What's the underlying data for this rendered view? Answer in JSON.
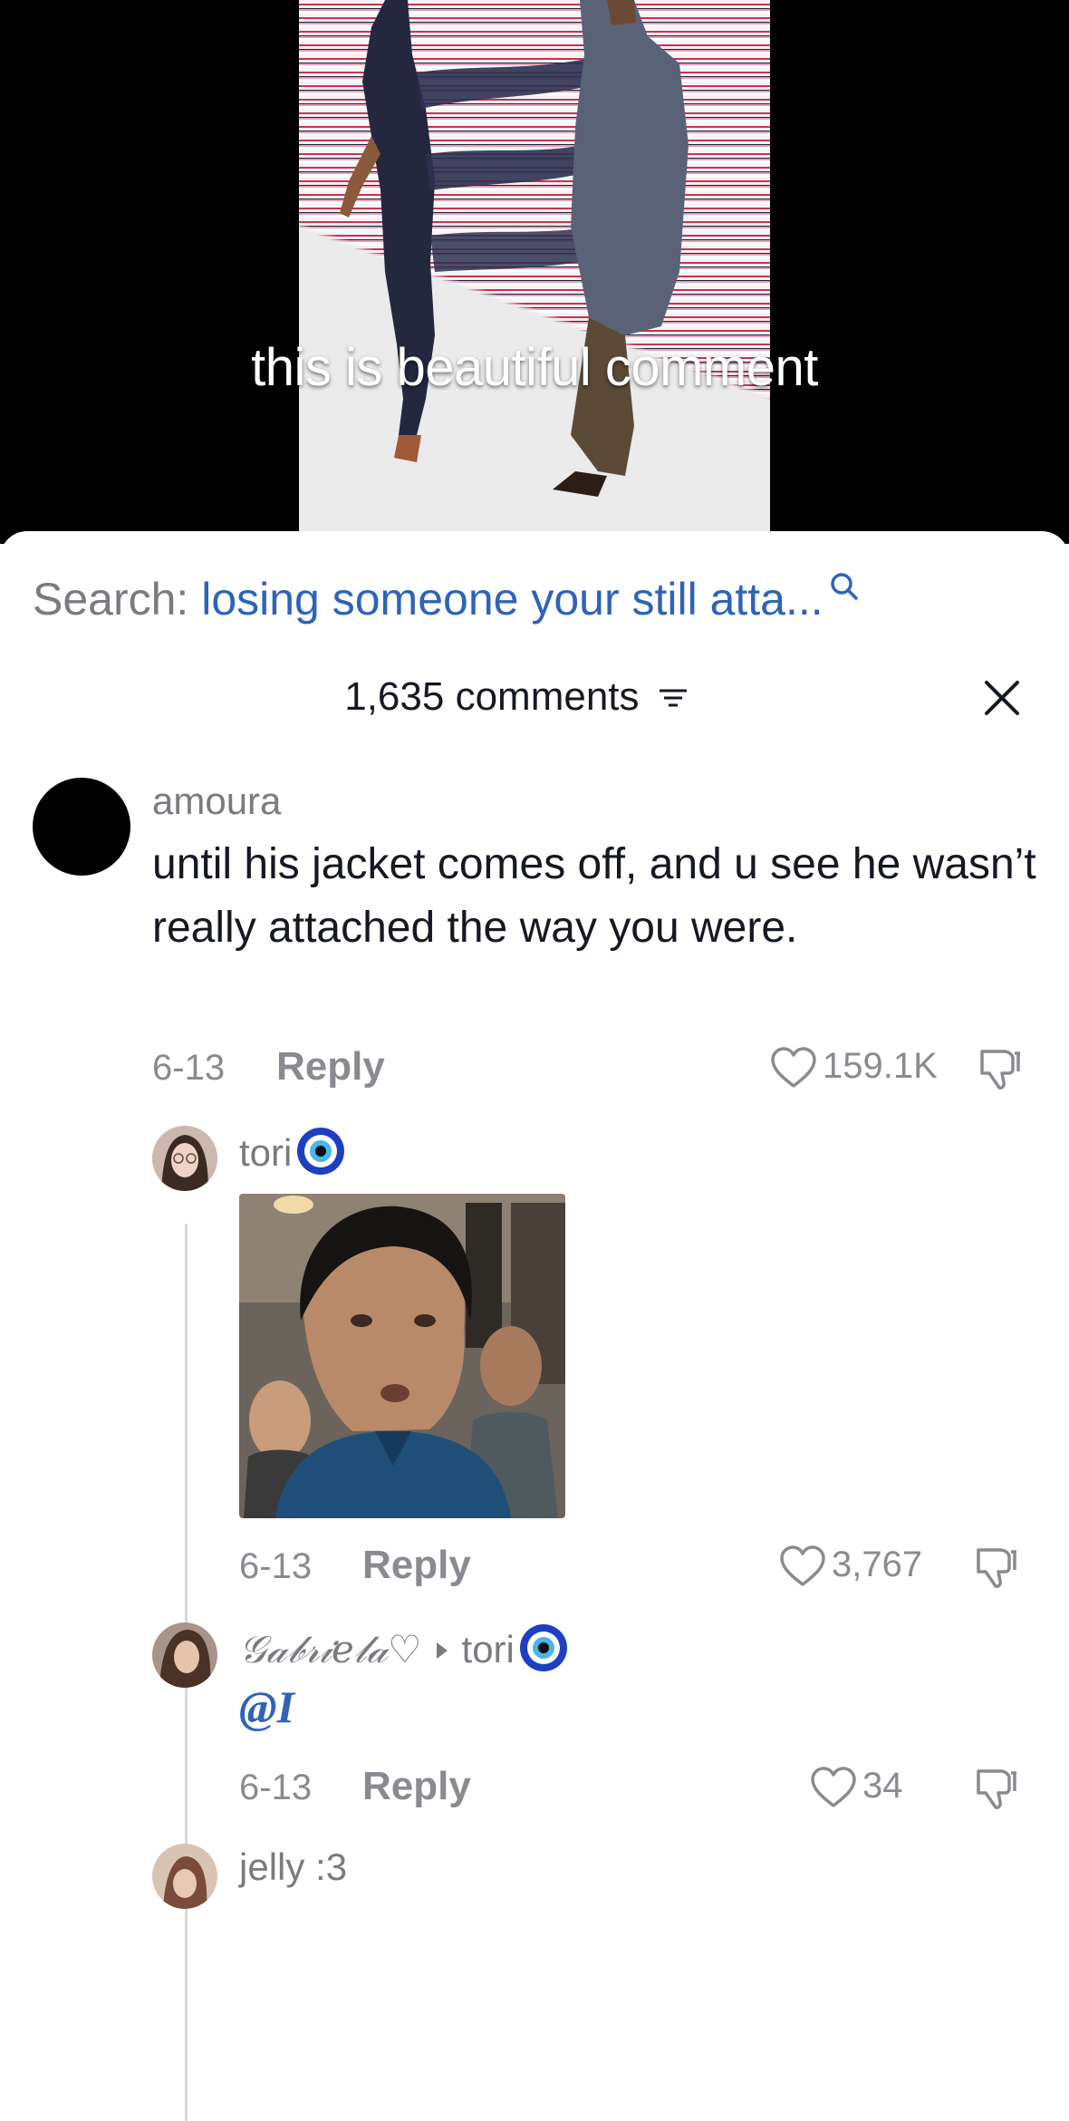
{
  "video": {
    "caption": "this is beautiful comment"
  },
  "search": {
    "label": "Search: ",
    "query": "losing someone your still atta...",
    "icon": "search-icon"
  },
  "comments_header": {
    "count_label": "1,635 comments",
    "filter_icon": "filter-icon",
    "close_icon": "close-icon"
  },
  "comments": [
    {
      "username": "amoura",
      "text": "until his jacket comes off, and u see he wasn’t really attached the way you were.",
      "date": "6-13",
      "reply_label": "Reply",
      "likes": "159.1K"
    }
  ],
  "replies": [
    {
      "username": "tori",
      "badge_icon": "evil-eye-icon",
      "media": "gif-reaction-image",
      "date": "6-13",
      "reply_label": "Reply",
      "likes": "3,767"
    },
    {
      "username": "𝒢𝒶𝒷𝓇𝒾𝑒𝓁𝒶♡",
      "reply_to": "tori",
      "text": "@I",
      "date": "6-13",
      "reply_label": "Reply",
      "likes": "34"
    },
    {
      "username": "jelly :3"
    }
  ],
  "colors": {
    "accent_blue": "#2f63b8",
    "muted_text": "#8a8b91",
    "primary_text": "#161823"
  }
}
